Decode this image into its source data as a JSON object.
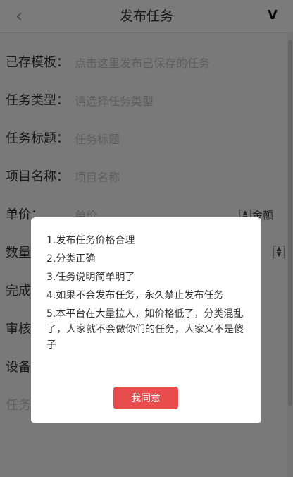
{
  "header": {
    "title": "发布任务",
    "back_glyph": "‹",
    "logo_text": "V"
  },
  "form": {
    "rows": [
      {
        "label": "已存模板：",
        "placeholder": "点击这里发布已保存的任务"
      },
      {
        "label": "任务类型：",
        "placeholder": "请选择任务类型"
      },
      {
        "label": "任务标题：",
        "placeholder": "任务标题"
      },
      {
        "label": "项目名称：",
        "placeholder": "项目名称"
      },
      {
        "label": "单价：",
        "placeholder": "单价",
        "unit": "金额"
      },
      {
        "label": "数量",
        "placeholder": ""
      },
      {
        "label": "完成",
        "placeholder": ""
      },
      {
        "label": "审核",
        "placeholder": ""
      },
      {
        "label": "设备",
        "placeholder": ""
      },
      {
        "label": "任务",
        "placeholder": ""
      }
    ]
  },
  "dialog": {
    "rules": [
      "1.发布任务价格合理",
      "2.分类正确",
      "3.任务说明简单明了",
      "4.如果不会发布任务，永久禁止发布任务",
      "5.本平台在大量拉人，如价格低了，分类混乱了，人家就不会做你们的任务，人家又不是傻子"
    ],
    "agree_label": "我同意"
  },
  "colors": {
    "accent": "#e94c4c",
    "overlay": "rgba(0,0,0,0.5)"
  }
}
